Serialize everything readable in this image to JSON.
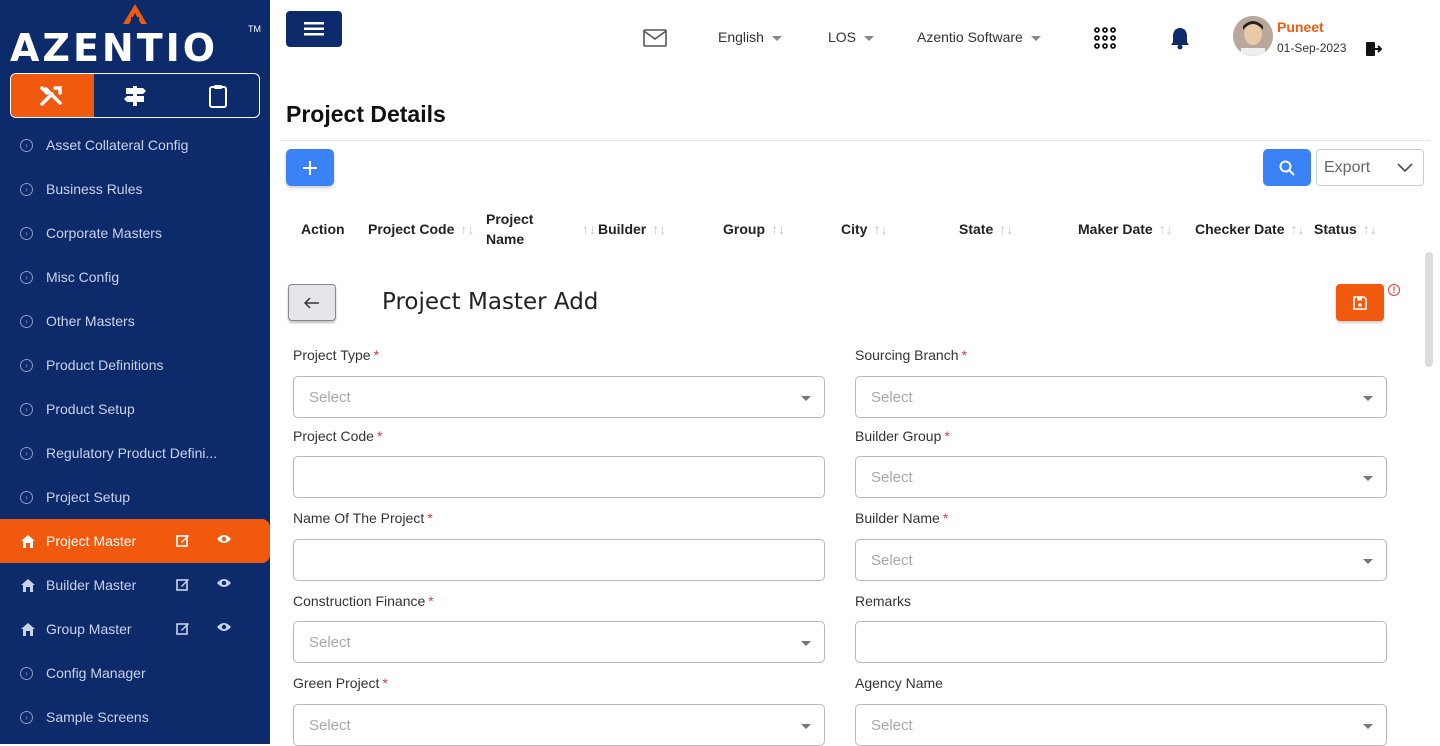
{
  "brand": {
    "name": "AZENTIO",
    "tm": "TM"
  },
  "sidebar": {
    "tabs": [
      {
        "icon": "tools-icon",
        "active": true
      },
      {
        "icon": "signpost-icon",
        "active": false
      },
      {
        "icon": "clipboard-icon",
        "active": false
      }
    ],
    "items": [
      {
        "label": "Asset Collateral Config"
      },
      {
        "label": "Business Rules"
      },
      {
        "label": "Corporate Masters"
      },
      {
        "label": "Misc Config"
      },
      {
        "label": "Other Masters"
      },
      {
        "label": "Product Definitions"
      },
      {
        "label": "Product Setup"
      },
      {
        "label": "Regulatory Product Defini..."
      },
      {
        "label": "Project Setup"
      },
      {
        "label": "Project Master"
      },
      {
        "label": "Builder Master"
      },
      {
        "label": "Group Master"
      },
      {
        "label": "Config Manager"
      },
      {
        "label": "Sample Screens"
      }
    ]
  },
  "header": {
    "language": "English",
    "module": "LOS",
    "company": "Azentio Software",
    "user_name": "Puneet",
    "user_date": "01-Sep-2023"
  },
  "page": {
    "title": "Project Details",
    "export_label": "Export"
  },
  "table": {
    "columns": [
      "Action",
      "Project Code",
      "Project Name",
      "Builder",
      "Group",
      "City",
      "State",
      "Maker Date",
      "Checker Date",
      "Status"
    ]
  },
  "form": {
    "title": "Project Master Add",
    "fields": [
      {
        "label": "Project Type",
        "placeholder": "Select",
        "required": true
      },
      {
        "label": "Sourcing Branch",
        "placeholder": "Select",
        "required": true
      },
      {
        "label": "Project Code",
        "placeholder": "",
        "required": true
      },
      {
        "label": "Builder Group",
        "placeholder": "Select",
        "required": true
      },
      {
        "label": "Name Of The Project",
        "placeholder": "",
        "required": true
      },
      {
        "label": "Builder Name",
        "placeholder": "Select",
        "required": true
      },
      {
        "label": "Construction Finance",
        "placeholder": "Select",
        "required": true
      },
      {
        "label": "Remarks",
        "placeholder": "",
        "required": false
      },
      {
        "label": "Green Project",
        "placeholder": "Select",
        "required": true
      },
      {
        "label": "Agency Name",
        "placeholder": "Select",
        "required": false
      }
    ],
    "required_mark": "*"
  },
  "colors": {
    "navy": "#0d2a6b",
    "accent": "#f15a0e",
    "primary": "#3b82f6"
  }
}
